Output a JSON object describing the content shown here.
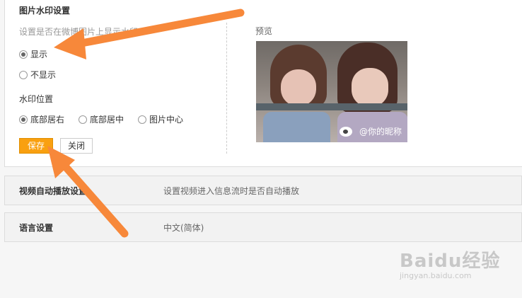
{
  "watermark": {
    "title": "图片水印设置",
    "description": "设置是否在微博图片上显示水印",
    "show_label": "显示",
    "hide_label": "不显示",
    "position_label": "水印位置",
    "positions": [
      "底部居右",
      "底部居中",
      "图片中心"
    ],
    "save_label": "保存",
    "close_label": "关闭",
    "preview_label": "预览",
    "preview_watermark_text": "@你的昵称"
  },
  "video_row": {
    "title": "视频自动播放设置",
    "value": "设置视频进入信息流时是否自动播放"
  },
  "language_row": {
    "title": "语言设置",
    "value": "中文(简体)"
  },
  "brand": {
    "name": "Baidu经验",
    "url_text": "jingyan.baidu.com"
  },
  "colors": {
    "accent": "#f9a010",
    "arrow": "#f7883a"
  }
}
